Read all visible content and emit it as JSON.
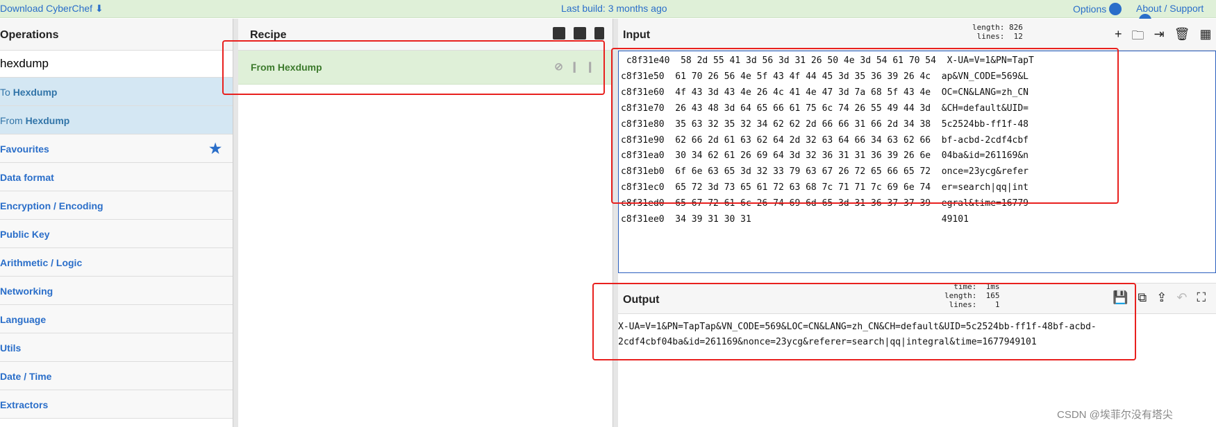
{
  "topbar": {
    "download": "Download CyberChef",
    "last_build": "Last build: 3 months ago",
    "options": "Options",
    "about": "About / Support"
  },
  "operations": {
    "title": "Operations",
    "search_value": "hexdump",
    "results": [
      {
        "prefix": "To ",
        "bold": "Hexdump"
      },
      {
        "prefix": "From ",
        "bold": "Hexdump"
      }
    ],
    "categories": [
      "Favourites",
      "Data format",
      "Encryption / Encoding",
      "Public Key",
      "Arithmetic / Logic",
      "Networking",
      "Language",
      "Utils",
      "Date / Time",
      "Extractors"
    ]
  },
  "recipe": {
    "title": "Recipe",
    "items": [
      {
        "name": "From Hexdump"
      }
    ]
  },
  "input": {
    "title": "Input",
    "stats": "length: 826\n lines:  12",
    "text": " c8f31e40  58 2d 55 41 3d 56 3d 31 26 50 4e 3d 54 61 70 54  X-UA=V=1&PN=TapT\nc8f31e50  61 70 26 56 4e 5f 43 4f 44 45 3d 35 36 39 26 4c  ap&VN_CODE=569&L\nc8f31e60  4f 43 3d 43 4e 26 4c 41 4e 47 3d 7a 68 5f 43 4e  OC=CN&LANG=zh_CN\nc8f31e70  26 43 48 3d 64 65 66 61 75 6c 74 26 55 49 44 3d  &CH=default&UID=\nc8f31e80  35 63 32 35 32 34 62 62 2d 66 66 31 66 2d 34 38  5c2524bb-ff1f-48\nc8f31e90  62 66 2d 61 63 62 64 2d 32 63 64 66 34 63 62 66  bf-acbd-2cdf4cbf\nc8f31ea0  30 34 62 61 26 69 64 3d 32 36 31 31 36 39 26 6e  04ba&id=261169&n\nc8f31eb0  6f 6e 63 65 3d 32 33 79 63 67 26 72 65 66 65 72  once=23ycg&refer\nc8f31ec0  65 72 3d 73 65 61 72 63 68 7c 71 71 7c 69 6e 74  er=search|qq|int\nc8f31ed0  65 67 72 61 6c 26 74 69 6d 65 3d 31 36 37 37 39  egral&time=16779\nc8f31ee0  34 39 31 30 31                                   49101\n"
  },
  "output": {
    "title": "Output",
    "stats": "  time:  1ms\nlength:  165\n lines:    1",
    "text": "X-UA=V=1&PN=TapTap&VN_CODE=569&LOC=CN&LANG=zh_CN&CH=default&UID=5c2524bb-ff1f-48bf-acbd-\n2cdf4cbf04ba&id=261169&nonce=23ycg&referer=search|qq|integral&time=1677949101"
  },
  "watermark": "CSDN @埃菲尔没有塔尖",
  "colors": {
    "accent": "#2a6ec9",
    "recipe_bg": "#dff0d8",
    "highlight": "#e8201e"
  }
}
